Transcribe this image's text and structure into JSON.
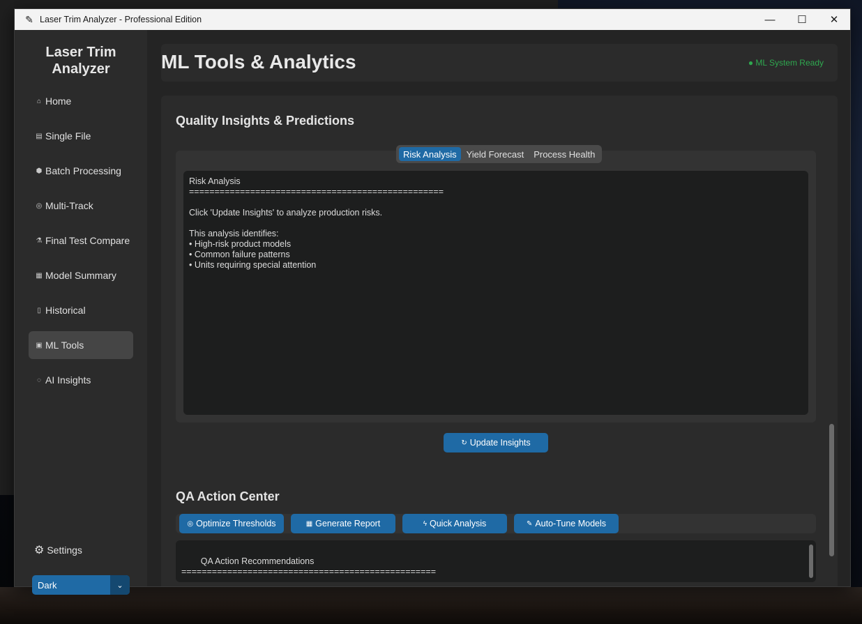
{
  "window": {
    "title": "Laser Trim Analyzer - Professional Edition",
    "controls": {
      "minimize": "—",
      "maximize": "☐",
      "close": "✕"
    }
  },
  "sidebar": {
    "app_title": "Laser Trim Analyzer",
    "items": [
      {
        "label": "Home",
        "icon": "home-icon",
        "glyph": "⌂"
      },
      {
        "label": "Single File",
        "icon": "file-icon",
        "glyph": "▤"
      },
      {
        "label": "Batch Processing",
        "icon": "package-icon",
        "glyph": "⬢"
      },
      {
        "label": "Multi-Track",
        "icon": "target-icon",
        "glyph": "◎"
      },
      {
        "label": "Final Test Compare",
        "icon": "flask-icon",
        "glyph": "⚗"
      },
      {
        "label": "Model Summary",
        "icon": "chart-icon",
        "glyph": "▦"
      },
      {
        "label": "Historical",
        "icon": "history-icon",
        "glyph": "▯"
      },
      {
        "label": "ML Tools",
        "icon": "robot-icon",
        "glyph": "▣",
        "active": true
      },
      {
        "label": "AI Insights",
        "icon": "lightbulb-icon",
        "glyph": "◌"
      }
    ],
    "settings_label": "Settings",
    "theme": {
      "value": "Dark"
    }
  },
  "header": {
    "title": "ML Tools & Analytics",
    "status": "● ML System Ready",
    "status_color": "#2fa84f"
  },
  "insights": {
    "section_title": "Quality Insights & Predictions",
    "tabs": [
      "Risk Analysis",
      "Yield Forecast",
      "Process Health"
    ],
    "active_tab": "Risk Analysis",
    "text": "Risk Analysis\n==================================================\n\nClick 'Update Insights' to analyze production risks.\n\nThis analysis identifies:\n• High-risk product models\n• Common failure patterns\n• Units requiring special attention",
    "update_button": "Update Insights"
  },
  "qa": {
    "section_title": "QA Action Center",
    "actions": [
      {
        "label": "Optimize Thresholds",
        "icon": "target-icon",
        "glyph": "◎"
      },
      {
        "label": "Generate Report",
        "icon": "report-icon",
        "glyph": "▦"
      },
      {
        "label": "Quick Analysis",
        "icon": "lightning-icon",
        "glyph": "ϟ"
      },
      {
        "label": "Auto-Tune Models",
        "icon": "wrench-icon",
        "glyph": "✎"
      }
    ],
    "text": "QA Action Recommendations\n=================================================="
  },
  "colors": {
    "accent": "#1f6aa5",
    "sidebar_bg": "#2b2b2b",
    "main_bg": "#242424"
  }
}
